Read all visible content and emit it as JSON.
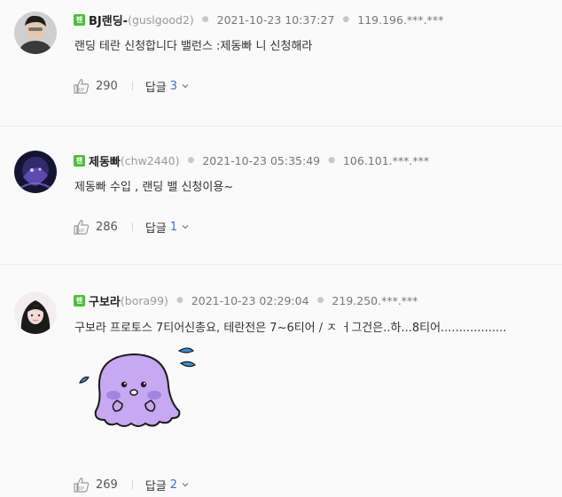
{
  "comments": [
    {
      "badge": "팬",
      "nickname": "BJ랜딩-",
      "user_id": "(guslgood2)",
      "date": "2021-10-23 10:37:27",
      "ip": "119.196.***.***",
      "text": "랜딩 테란 신청합니다 밸런스 :제동빠 니 신청해라",
      "likes": "290",
      "reply_label": "답글",
      "reply_count": "3"
    },
    {
      "badge": "팬",
      "nickname": "제동빠",
      "user_id": "(chw2440)",
      "date": "2021-10-23 05:35:49",
      "ip": "106.101.***.***",
      "text": "제동빠  수입 , 랜딩 밸 신청이용~",
      "likes": "286",
      "reply_label": "답글",
      "reply_count": "1"
    },
    {
      "badge": "팬",
      "nickname": "구보라",
      "user_id": "(bora99)",
      "date": "2021-10-23 02:29:04",
      "ip": "219.250.***.***",
      "text": "구보라 프로토스 7티어신총요, 테란전은 7~6티어 / ㅈ ㅓ그건은..하...8티어..................",
      "likes": "269",
      "reply_label": "답글",
      "reply_count": "2"
    }
  ],
  "colors": {
    "fan_badge": "#4dbf3a",
    "reply_count": "#3a72d8",
    "emoticon_body": "#c7a8f2",
    "emoticon_tear": "#3b8fd8"
  },
  "icons": [
    "like-icon",
    "chevron-down-icon"
  ]
}
